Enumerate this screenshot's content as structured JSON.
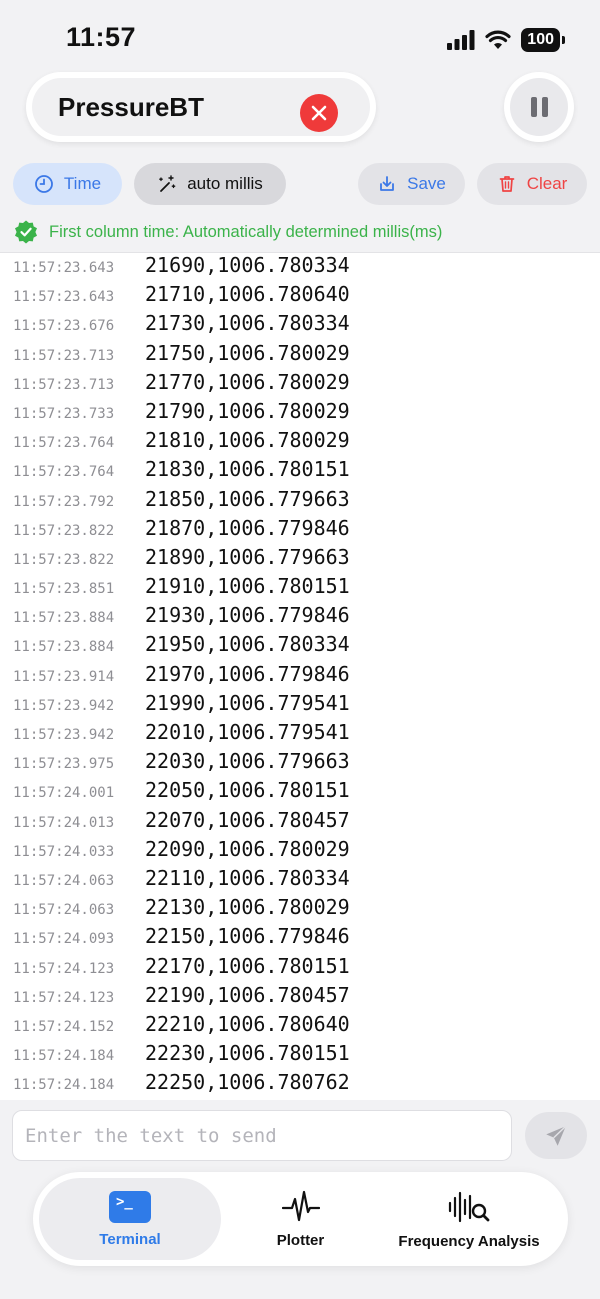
{
  "status_bar": {
    "time": "11:57",
    "battery": "100"
  },
  "header": {
    "title": "PressureBT"
  },
  "toolbar": {
    "time_label": "Time",
    "auto_label": "auto millis",
    "save_label": "Save",
    "clear_label": "Clear"
  },
  "info": {
    "text": "First column time: Automatically determined millis(ms)"
  },
  "terminal": {
    "rows": [
      {
        "ts": "11:57:23.643",
        "val": "21690,1006.780334"
      },
      {
        "ts": "11:57:23.643",
        "val": "21710,1006.780640"
      },
      {
        "ts": "11:57:23.676",
        "val": "21730,1006.780334"
      },
      {
        "ts": "11:57:23.713",
        "val": "21750,1006.780029"
      },
      {
        "ts": "11:57:23.713",
        "val": "21770,1006.780029"
      },
      {
        "ts": "11:57:23.733",
        "val": "21790,1006.780029"
      },
      {
        "ts": "11:57:23.764",
        "val": "21810,1006.780029"
      },
      {
        "ts": "11:57:23.764",
        "val": "21830,1006.780151"
      },
      {
        "ts": "11:57:23.792",
        "val": "21850,1006.779663"
      },
      {
        "ts": "11:57:23.822",
        "val": "21870,1006.779846"
      },
      {
        "ts": "11:57:23.822",
        "val": "21890,1006.779663"
      },
      {
        "ts": "11:57:23.851",
        "val": "21910,1006.780151"
      },
      {
        "ts": "11:57:23.884",
        "val": "21930,1006.779846"
      },
      {
        "ts": "11:57:23.884",
        "val": "21950,1006.780334"
      },
      {
        "ts": "11:57:23.914",
        "val": "21970,1006.779846"
      },
      {
        "ts": "11:57:23.942",
        "val": "21990,1006.779541"
      },
      {
        "ts": "11:57:23.942",
        "val": "22010,1006.779541"
      },
      {
        "ts": "11:57:23.975",
        "val": "22030,1006.779663"
      },
      {
        "ts": "11:57:24.001",
        "val": "22050,1006.780151"
      },
      {
        "ts": "11:57:24.013",
        "val": "22070,1006.780457"
      },
      {
        "ts": "11:57:24.033",
        "val": "22090,1006.780029"
      },
      {
        "ts": "11:57:24.063",
        "val": "22110,1006.780334"
      },
      {
        "ts": "11:57:24.063",
        "val": "22130,1006.780029"
      },
      {
        "ts": "11:57:24.093",
        "val": "22150,1006.779846"
      },
      {
        "ts": "11:57:24.123",
        "val": "22170,1006.780151"
      },
      {
        "ts": "11:57:24.123",
        "val": "22190,1006.780457"
      },
      {
        "ts": "11:57:24.152",
        "val": "22210,1006.780640"
      },
      {
        "ts": "11:57:24.184",
        "val": "22230,1006.780151"
      },
      {
        "ts": "11:57:24.184",
        "val": "22250,1006.780762"
      }
    ]
  },
  "send": {
    "placeholder": "Enter the text to send"
  },
  "tabs": {
    "terminal": "Terminal",
    "plotter": "Plotter",
    "frequency": "Frequency Analysis"
  },
  "colors": {
    "accent": "#2f7be8",
    "danger": "#ef3a3a",
    "success": "#3bb34a"
  },
  "icons": {
    "status": [
      "signal-icon",
      "wifi-icon",
      "battery-icon"
    ],
    "toolbar": [
      "clock-icon",
      "magic-wand-icon",
      "save-icon",
      "trash-icon"
    ],
    "tabs": [
      "terminal-icon",
      "waveform-icon",
      "frequency-search-icon"
    ]
  }
}
